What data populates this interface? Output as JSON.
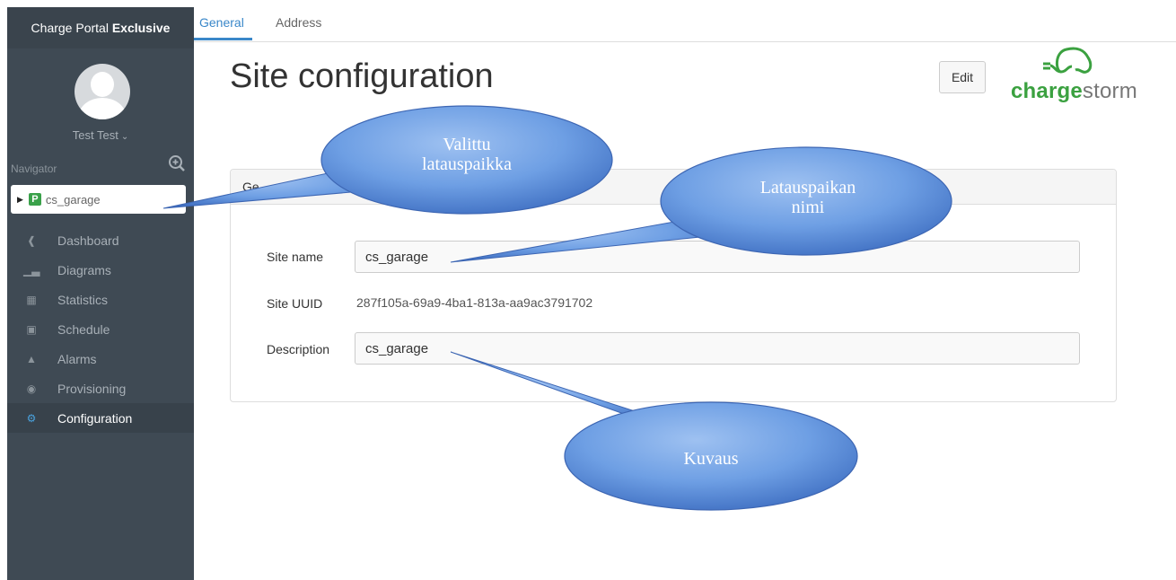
{
  "sidebar": {
    "brand_prefix": "Charge Portal",
    "brand_bold": "Exclusive",
    "user_name": "Test Test",
    "navigator_label": "Navigator",
    "selected_site": "cs_garage",
    "site_badge": "P",
    "items": [
      {
        "label": "Dashboard",
        "icon": "home-icon"
      },
      {
        "label": "Diagrams",
        "icon": "bar-chart-icon"
      },
      {
        "label": "Statistics",
        "icon": "table-icon"
      },
      {
        "label": "Schedule",
        "icon": "calendar-icon"
      },
      {
        "label": "Alarms",
        "icon": "warning-icon"
      },
      {
        "label": "Provisioning",
        "icon": "users-icon"
      },
      {
        "label": "Configuration",
        "icon": "gear-icon",
        "active": true
      }
    ]
  },
  "tabs": [
    {
      "label": "General",
      "active": true
    },
    {
      "label": "Address"
    }
  ],
  "main": {
    "title": "Site configuration",
    "edit_label": "Edit",
    "logo_charge": "charge",
    "logo_storm": "storm",
    "panel_heading": "Ge",
    "fields": {
      "site_name_label": "Site name",
      "site_name_value": "cs_garage",
      "site_uuid_label": "Site UUID",
      "site_uuid_value": "287f105a-69a9-4ba1-813a-aa9ac3791702",
      "description_label": "Description",
      "description_value": "cs_garage"
    }
  },
  "callouts": {
    "selected_site_line1": "Valittu",
    "selected_site_line2": "latauspaikka",
    "site_name_line1": "Latauspaikan",
    "site_name_line2": "nimi",
    "description": "Kuvaus"
  },
  "colors": {
    "sidebar_bg": "#3f4a54",
    "accent_blue": "#3a87c9",
    "logo_green": "#3ba140",
    "callout_blue": "#5d8fd9"
  }
}
